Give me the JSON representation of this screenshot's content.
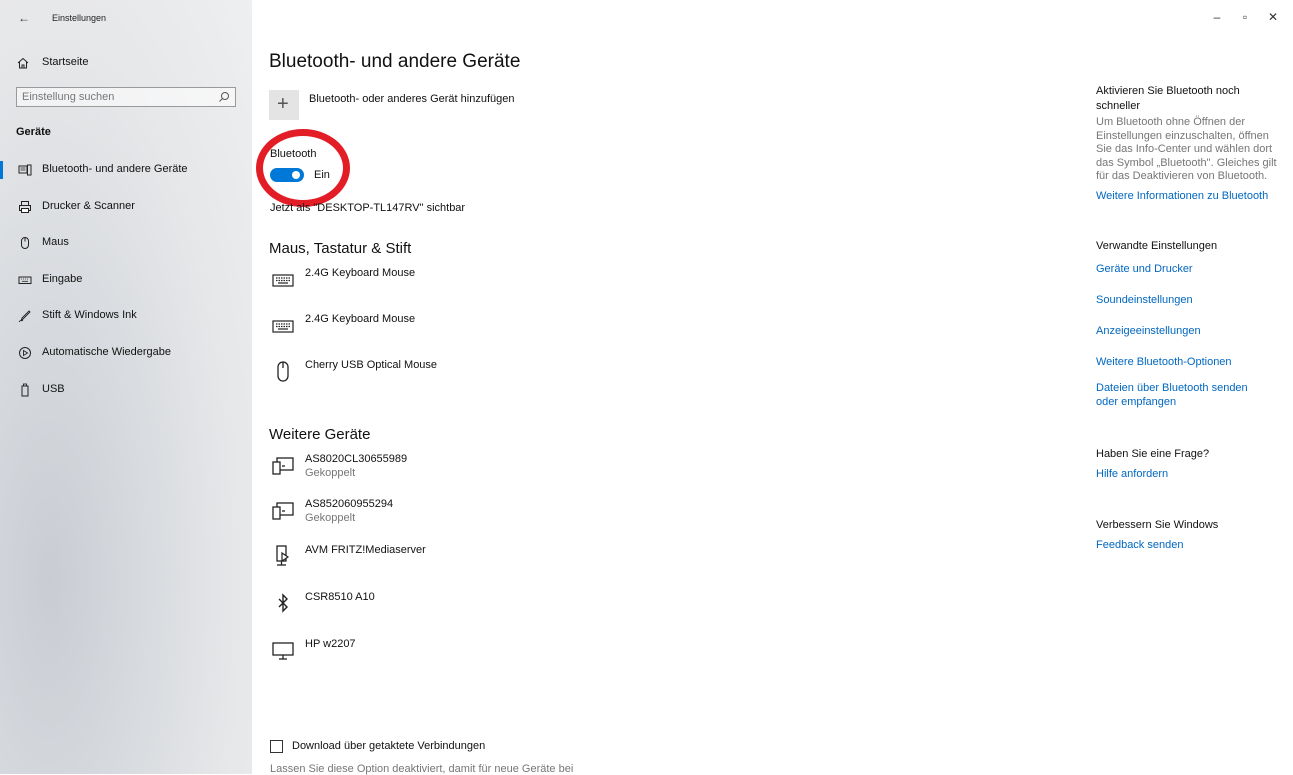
{
  "window": {
    "back_glyph": "←",
    "title": "Einstellungen",
    "controls": {
      "minimize": "–",
      "restore": "▫",
      "close": "✕"
    }
  },
  "sidebar": {
    "home_label": "Startseite",
    "search_placeholder": "Einstellung suchen",
    "group_title": "Geräte",
    "items": [
      {
        "label": "Bluetooth- und andere Geräte",
        "icon": "bluetooth-devices-icon",
        "active": true
      },
      {
        "label": "Drucker & Scanner",
        "icon": "printer-icon",
        "active": false
      },
      {
        "label": "Maus",
        "icon": "mouse-icon",
        "active": false
      },
      {
        "label": "Eingabe",
        "icon": "keyboard-icon",
        "active": false
      },
      {
        "label": "Stift & Windows Ink",
        "icon": "pen-icon",
        "active": false
      },
      {
        "label": "Automatische Wiedergabe",
        "icon": "autoplay-icon",
        "active": false
      },
      {
        "label": "USB",
        "icon": "usb-icon",
        "active": false
      }
    ]
  },
  "main": {
    "title": "Bluetooth- und andere Geräte",
    "add_device_label": "Bluetooth- oder anderes Gerät hinzufügen",
    "bluetooth_label": "Bluetooth",
    "bluetooth_state": "Ein",
    "visible_as": "Jetzt als \"DESKTOP-TL147RV\" sichtbar",
    "section_input": "Maus, Tastatur & Stift",
    "input_devices": [
      {
        "name": "2.4G Keyboard Mouse",
        "icon": "keyboard-icon"
      },
      {
        "name": "2.4G Keyboard Mouse",
        "icon": "keyboard-icon"
      },
      {
        "name": "Cherry USB Optical Mouse",
        "icon": "mouse-icon"
      }
    ],
    "section_other": "Weitere Geräte",
    "other_devices": [
      {
        "name": "AS8020CL30655989",
        "status": "Gekoppelt",
        "icon": "device-icon"
      },
      {
        "name": "AS852060955294",
        "status": "Gekoppelt",
        "icon": "device-icon"
      },
      {
        "name": "AVM FRITZ!Mediaserver",
        "status": "",
        "icon": "media-server-icon"
      },
      {
        "name": "CSR8510 A10",
        "status": "",
        "icon": "bluetooth-icon"
      },
      {
        "name": "HP w2207",
        "status": "",
        "icon": "monitor-icon"
      }
    ],
    "metered_checkbox_label": "Download über getaktete Verbindungen",
    "metered_description": "Lassen Sie diese Option deaktiviert, damit für neue Geräte bei",
    "metered_checked": false
  },
  "right": {
    "tip_title": "Aktivieren Sie Bluetooth noch schneller",
    "tip_text": "Um Bluetooth ohne Öffnen der Einstellungen einzuschalten, öffnen Sie das Info-Center und wählen dort das Symbol „Bluetooth\". Gleiches gilt für das Deaktivieren von Bluetooth.",
    "tip_link": "Weitere Informationen zu Bluetooth",
    "related_title": "Verwandte Einstellungen",
    "related_links": [
      "Geräte und Drucker",
      "Soundeinstellungen",
      "Anzeigeeinstellungen",
      "Weitere Bluetooth-Optionen",
      "Dateien über Bluetooth senden oder empfangen"
    ],
    "question_title": "Haben Sie eine Frage?",
    "question_link": "Hilfe anfordern",
    "improve_title": "Verbessern Sie Windows",
    "improve_link": "Feedback senden"
  },
  "colors": {
    "accent": "#0078d7",
    "link": "#0067c0",
    "highlight_ring": "#e21d25"
  }
}
